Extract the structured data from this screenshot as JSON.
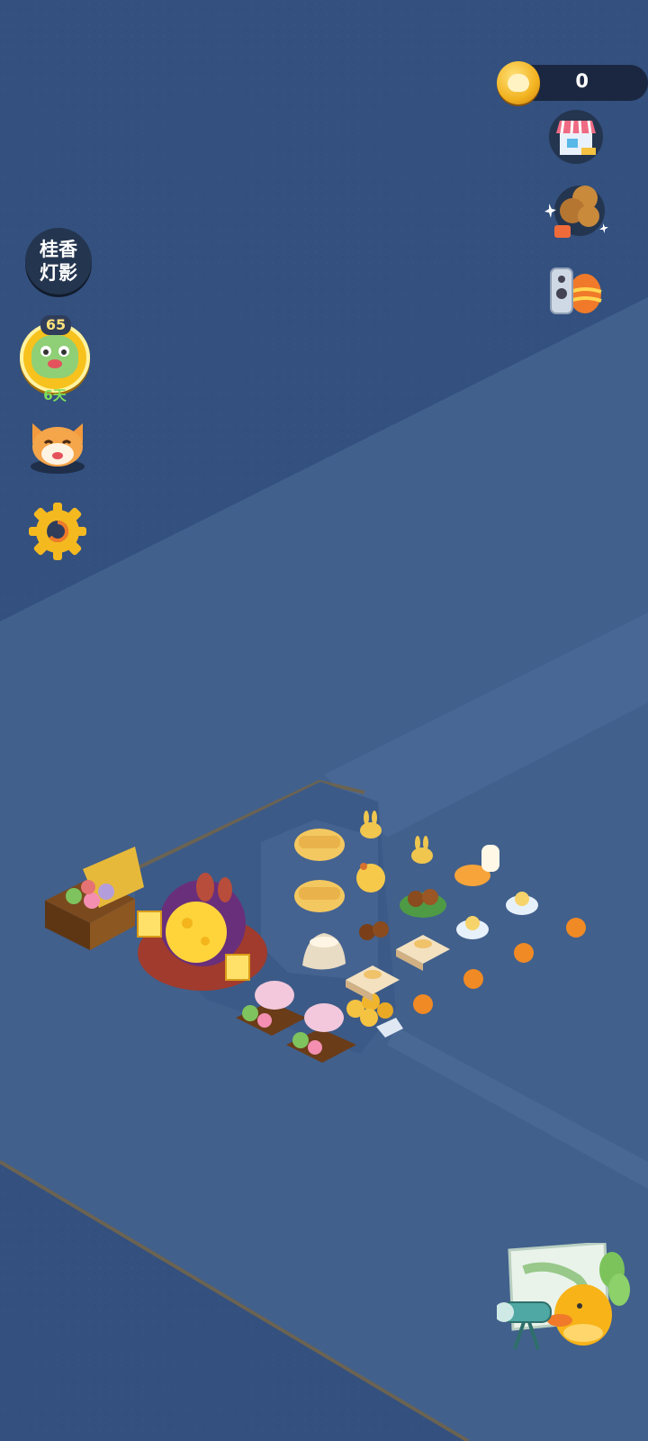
{
  "hud": {
    "coin_count": "0",
    "coin_icon": "bunny-coin-icon"
  },
  "left_menu": {
    "event": {
      "line1": "桂香",
      "line2": "灯影"
    },
    "level": {
      "badge": "65",
      "days": "6天",
      "icon": "frog-avatar-icon"
    },
    "cat_icon": "fox-cat-avatar-icon",
    "settings_icon": "gear-icon"
  },
  "right_menu": {
    "shop_icon": "shop-stall-icon",
    "mooncake_icon": "mooncake-gift-icon",
    "remote_icon": "remote-egg-icon",
    "map_icon": "map-duck-icon"
  },
  "colors": {
    "water": "#33507f",
    "coin_gold": "#f2b21f",
    "hud_dark": "#1b2740",
    "days_green": "#7ee05b"
  }
}
